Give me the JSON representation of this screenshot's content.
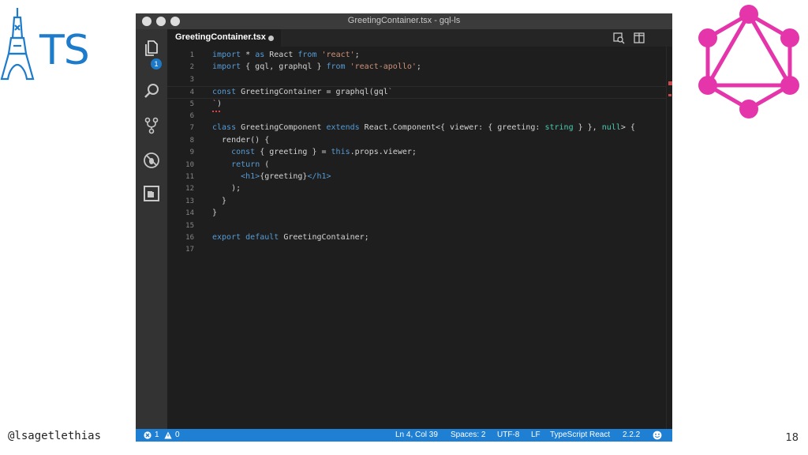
{
  "slide": {
    "ts_logo_text": "TS",
    "handle": "@lsagetlethias",
    "page_number": "18",
    "graphql_color": "#e535ab",
    "ts_color": "#1d7bcc"
  },
  "window": {
    "title": "GreetingContainer.tsx - gql-ls",
    "traffic_lights": [
      "close",
      "minimize",
      "maximize"
    ]
  },
  "activity_bar": {
    "items": [
      {
        "icon": "files-icon",
        "badge": "1"
      },
      {
        "icon": "search-icon"
      },
      {
        "icon": "source-control-icon"
      },
      {
        "icon": "debug-icon"
      },
      {
        "icon": "extensions-icon"
      }
    ]
  },
  "tabs": [
    {
      "label": "GreetingContainer.tsx",
      "modified": true
    }
  ],
  "editor_actions": [
    "open-changes-icon",
    "split-editor-icon"
  ],
  "editor": {
    "lines": [
      {
        "n": "1",
        "text": "import * as React from 'react';"
      },
      {
        "n": "2",
        "text": "import { gql, graphql } from 'react-apollo';"
      },
      {
        "n": "3",
        "text": ""
      },
      {
        "n": "4",
        "text": "const GreetingContainer = graphql(gql`"
      },
      {
        "n": "5",
        "text": "`)"
      },
      {
        "n": "6",
        "text": ""
      },
      {
        "n": "7",
        "text": "class GreetingComponent extends React.Component<{ viewer: { greeting: string } }, null> {"
      },
      {
        "n": "8",
        "text": "  render() {"
      },
      {
        "n": "9",
        "text": "    const { greeting } = this.props.viewer;"
      },
      {
        "n": "10",
        "text": "    return ("
      },
      {
        "n": "11",
        "text": "      <h1>{greeting}</h1>"
      },
      {
        "n": "12",
        "text": "    );"
      },
      {
        "n": "13",
        "text": "  }"
      },
      {
        "n": "14",
        "text": "}"
      },
      {
        "n": "15",
        "text": ""
      },
      {
        "n": "16",
        "text": "export default GreetingContainer;"
      },
      {
        "n": "17",
        "text": ""
      }
    ],
    "current_line": "4",
    "error_line": "5"
  },
  "status_bar": {
    "errors": "1",
    "warnings": "0",
    "position": "Ln 4, Col 39",
    "spaces": "Spaces: 2",
    "encoding": "UTF-8",
    "eol": "LF",
    "language": "TypeScript React",
    "version": "2.2.2",
    "feedback_icon": "smiley-icon",
    "color": "#1f7fd3"
  }
}
